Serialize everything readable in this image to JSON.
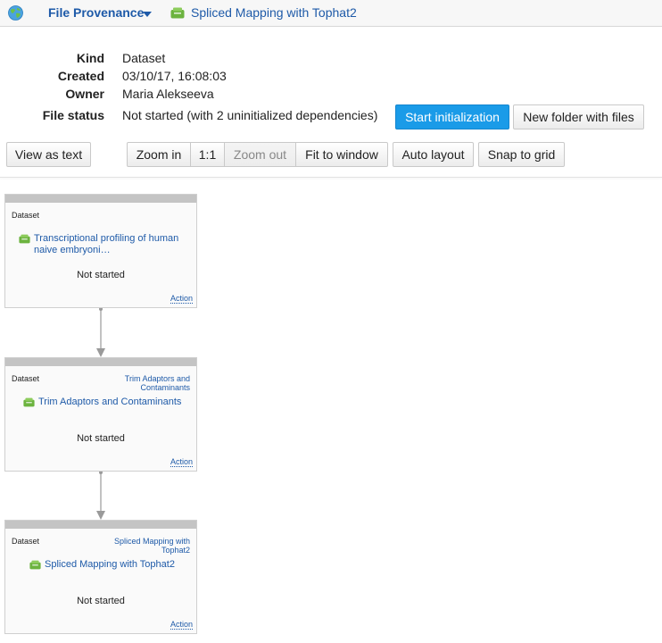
{
  "header": {
    "menu_title": "File Provenance",
    "breadcrumb": "Spliced Mapping with Tophat2"
  },
  "info": {
    "kind_label": "Kind",
    "kind_value": "Dataset",
    "created_label": "Created",
    "created_value": "03/10/17, 16:08:03",
    "owner_label": "Owner",
    "owner_value": "Maria Alekseeva",
    "status_label": "File status",
    "status_value": "Not started (with 2 uninitialized dependencies)"
  },
  "actions": {
    "start_init": "Start initialization",
    "new_folder": "New folder with files"
  },
  "toolbar": {
    "view_as_text": "View as text",
    "zoom_in": "Zoom in",
    "one_to_one": "1:1",
    "zoom_out": "Zoom out",
    "fit_to_window": "Fit to window",
    "auto_layout": "Auto layout",
    "snap_to_grid": "Snap to grid"
  },
  "nodes": [
    {
      "kind": "Dataset",
      "job": "",
      "title": "Transcriptional profiling of human naive embryoni…",
      "status": "Not started",
      "action": "Action"
    },
    {
      "kind": "Dataset",
      "job": "Trim Adaptors and Contaminants",
      "title": "Trim Adaptors and Contaminants",
      "status": "Not started",
      "action": "Action"
    },
    {
      "kind": "Dataset",
      "job": "Spliced Mapping with Tophat2",
      "title": "Spliced Mapping with Tophat2",
      "status": "Not started",
      "action": "Action"
    }
  ],
  "colors": {
    "link": "#1e5aa8",
    "primary_button": "#1a9be8",
    "dataset_icon": "#6cb33f",
    "node_header": "#c4c4c4"
  },
  "icons": {
    "app": "globe-icon",
    "dataset": "dataset-icon",
    "dropdown": "chevron-down-icon"
  }
}
